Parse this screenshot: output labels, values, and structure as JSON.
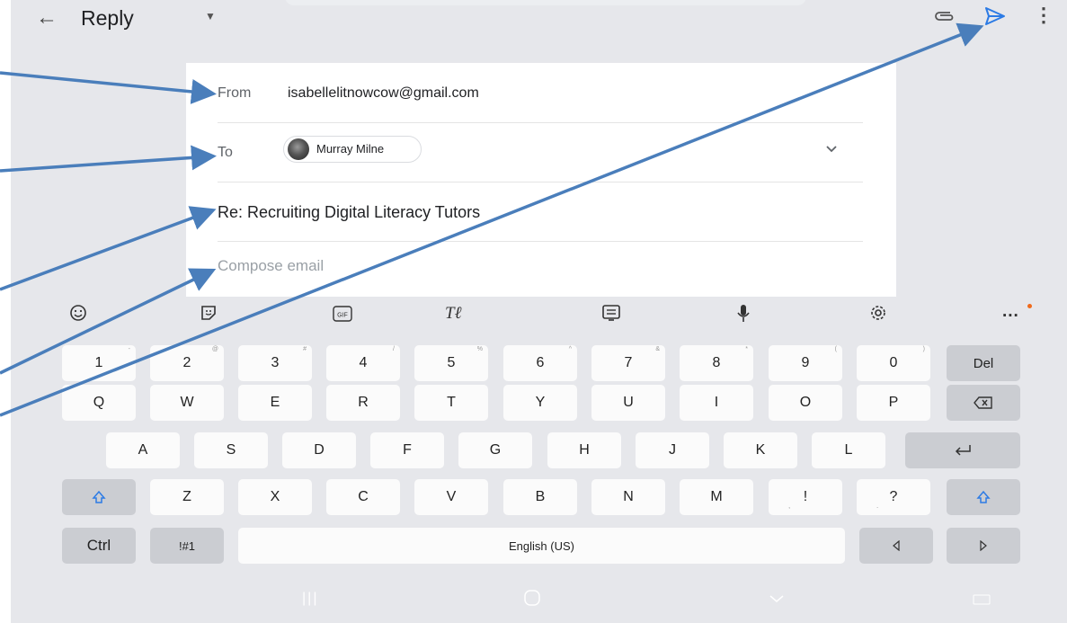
{
  "header": {
    "back_icon": "arrow-left-icon",
    "title": "Reply",
    "dropdown_icon": "caret-down-icon",
    "attach_icon": "paperclip-icon",
    "send_icon": "send-icon",
    "more_icon": "more-vert-icon",
    "accent": "#2c7be5"
  },
  "compose": {
    "from_label": "From",
    "from_value": "isabellelitnowcow@gmail.com",
    "to_label": "To",
    "to_chip": "Murray Milne",
    "to_expand_icon": "chevron-down-icon",
    "subject": "Re: Recruiting Digital Literacy Tutors",
    "body_placeholder": "Compose email"
  },
  "keyboard": {
    "toolbar_icons": [
      "emoji-icon",
      "sticker-icon",
      "gif-icon",
      "handwriting-icon",
      "clipboard-icon",
      "mic-icon",
      "settings-icon",
      "more-horiz-icon"
    ],
    "toolbar": {
      "gif": "GIF",
      "more": "..."
    },
    "number_row": [
      "1",
      "2",
      "3",
      "4",
      "5",
      "6",
      "7",
      "8",
      "9",
      "0",
      "Del"
    ],
    "row1": [
      "Q",
      "W",
      "E",
      "R",
      "T",
      "Y",
      "U",
      "I",
      "O",
      "P"
    ],
    "row2": [
      "A",
      "S",
      "D",
      "F",
      "G",
      "H",
      "J",
      "K",
      "L"
    ],
    "row3": [
      "Z",
      "X",
      "C",
      "V",
      "B",
      "N",
      "M",
      "!",
      "?"
    ],
    "row3_sub": [
      ",",
      "."
    ],
    "bottom": {
      "ctrl": "Ctrl",
      "symbols": "!#1",
      "space": "English (US)"
    }
  },
  "navbar": {
    "icons": [
      "recent-apps-icon",
      "home-icon",
      "back-icon",
      "keyboard-switch-icon"
    ]
  },
  "annotations": {
    "arrow_color": "#4a7ebb"
  }
}
